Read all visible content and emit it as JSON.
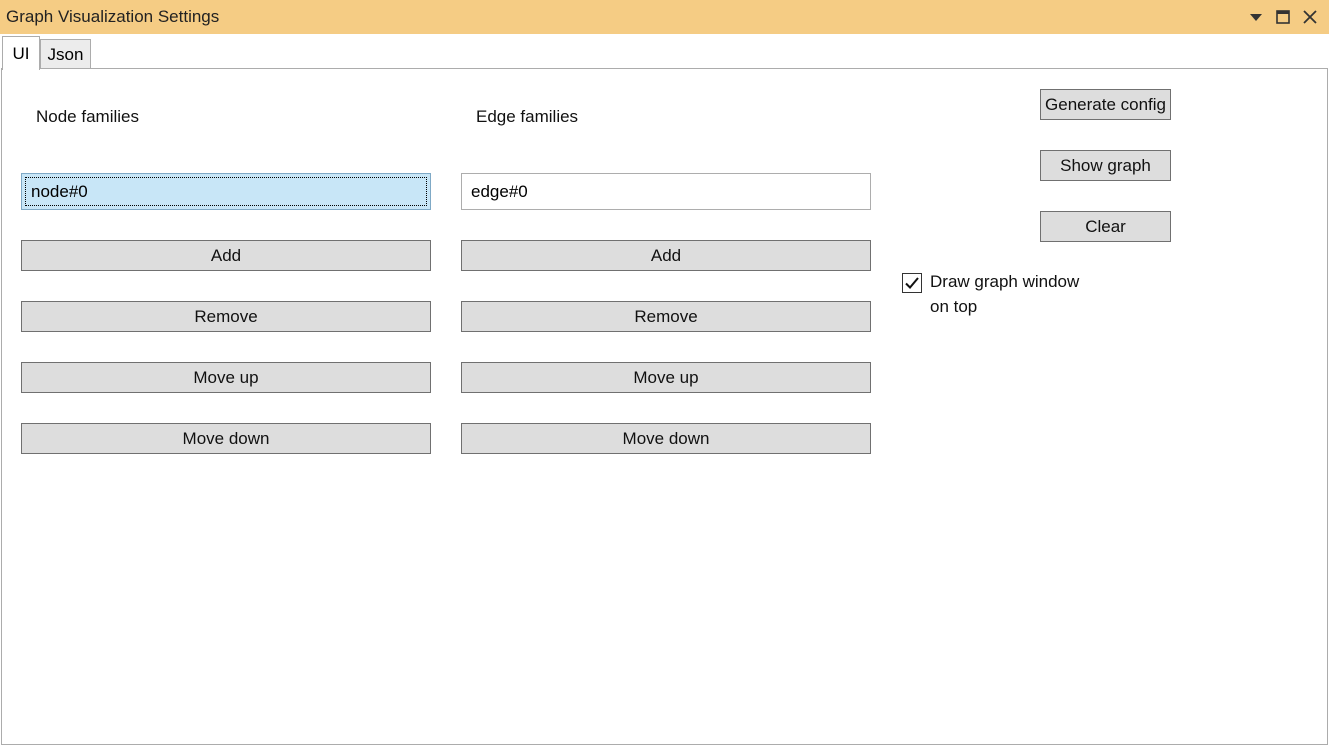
{
  "window": {
    "title": "Graph Visualization Settings",
    "controls": [
      "dropdown-icon",
      "maximize-icon",
      "close-icon"
    ]
  },
  "tabs": [
    {
      "label": "UI",
      "active": true
    },
    {
      "label": "Json",
      "active": false
    }
  ],
  "node_panel": {
    "heading": "Node families",
    "value": "node#0",
    "add_label": "Add",
    "remove_label": "Remove",
    "move_up_label": "Move up",
    "move_down_label": "Move down"
  },
  "edge_panel": {
    "heading": "Edge families",
    "value": "edge#0",
    "add_label": "Add",
    "remove_label": "Remove",
    "move_up_label": "Move up",
    "move_down_label": "Move down"
  },
  "actions": {
    "generate_config_label": "Generate config",
    "show_graph_label": "Show graph",
    "clear_label": "Clear"
  },
  "options": {
    "on_top_line1": "Draw graph window",
    "on_top_line2": "on top",
    "on_top_checked": true
  },
  "colors": {
    "titlebar": "#f5cc84",
    "button_bg": "#dddddd",
    "focused_field": "#c8e6f7"
  }
}
